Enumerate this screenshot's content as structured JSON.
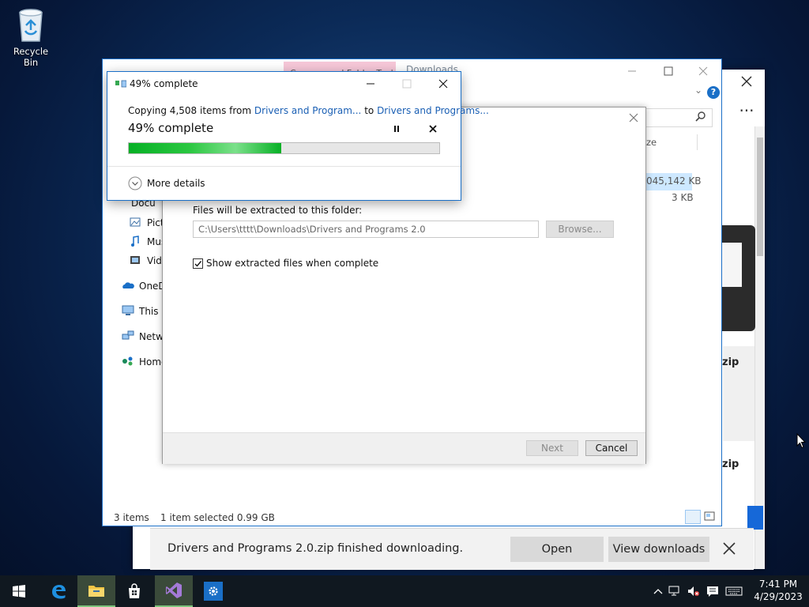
{
  "desktop": {
    "recycle_bin_label": "Recycle Bin"
  },
  "browser": {
    "more_label": "···",
    "partial_link_text": "d",
    "zip_label_1": "zip",
    "zip_label_2": "zip",
    "download_bar": {
      "message": "Drivers and Programs 2.0.zip finished downloading.",
      "open_label": "Open",
      "view_downloads_label": "View downloads"
    }
  },
  "explorer": {
    "ribbon_tab_label": "Compressed Folder Tools",
    "location_tab_label": "Downloads",
    "help_label": "?",
    "column_size_header": "ze",
    "rows": [
      {
        "size": "045,142 KB"
      },
      {
        "size": "3 KB"
      }
    ],
    "nav_items": [
      {
        "label": "Docu",
        "icon": "documents-icon"
      },
      {
        "label": "Pictu",
        "icon": "pictures-icon"
      },
      {
        "label": "Musi",
        "icon": "music-icon"
      },
      {
        "label": "Vide",
        "icon": "videos-icon"
      },
      {
        "label": "OneD",
        "icon": "onedrive-icon"
      },
      {
        "label": "This P",
        "icon": "this-pc-icon"
      },
      {
        "label": "Netwo",
        "icon": "network-icon"
      },
      {
        "label": "Home",
        "icon": "homegroup-icon"
      }
    ],
    "status_items": "3 items",
    "status_selected": "1 item selected  0.99 GB"
  },
  "extract_wizard": {
    "folder_label": "Files will be extracted to this folder:",
    "path_value": "C:\\Users\\tttt\\Downloads\\Drivers and Programs 2.0",
    "browse_label": "Browse...",
    "show_files_label": "Show extracted files when complete",
    "show_files_checked": true,
    "next_label": "Next",
    "cancel_label": "Cancel"
  },
  "copy_dialog": {
    "title": "49% complete",
    "copy_prefix": "Copying 4,508 items from ",
    "source_link": "Drivers and Program...",
    "copy_to": " to ",
    "dest_link": "Drivers and Programs...",
    "percent_text": "49% complete",
    "progress": 0.49,
    "more_details_label": "More details"
  },
  "taskbar": {
    "items": [
      "start-icon",
      "edge-icon",
      "file-explorer-icon",
      "store-icon",
      "visual-studio-icon",
      "settings-icon"
    ],
    "time": "7:41 PM",
    "date": "4/29/2023"
  },
  "colors": {
    "accent": "#1a6fc7",
    "progress_green": "#06b025",
    "taskbar": "#101820",
    "link": "#1a5fb4"
  }
}
